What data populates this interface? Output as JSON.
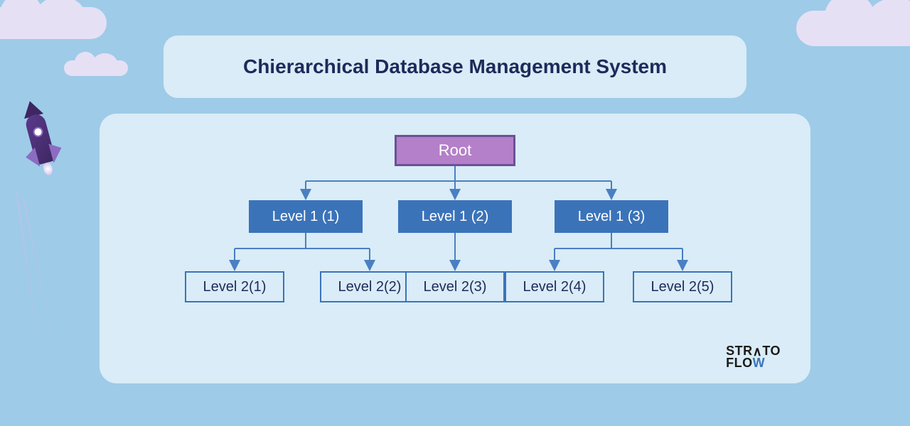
{
  "title": "Chierarchical Database Management System",
  "tree": {
    "root": {
      "label": "Root"
    },
    "level1": [
      {
        "label": "Level 1 (1)"
      },
      {
        "label": "Level 1 (2)"
      },
      {
        "label": "Level 1 (3)"
      }
    ],
    "level2": [
      {
        "label": "Level 2(1)"
      },
      {
        "label": "Level 2(2)"
      },
      {
        "label": "Level 2(3)"
      },
      {
        "label": "Level 2(4)"
      },
      {
        "label": "Level 2(5)"
      }
    ]
  },
  "logo": {
    "line1": "STRATO",
    "line2_pre": "FLO",
    "line2_accent": "W"
  },
  "colors": {
    "bg": "#9ecbe8",
    "panel": "#d9ecf7",
    "root_fill": "#b480c9",
    "root_border": "#6b5197",
    "l1_fill": "#3b73b9",
    "l2_border": "#3b73b9",
    "title_text": "#1e2a5a",
    "connector": "#4a7fc2"
  }
}
